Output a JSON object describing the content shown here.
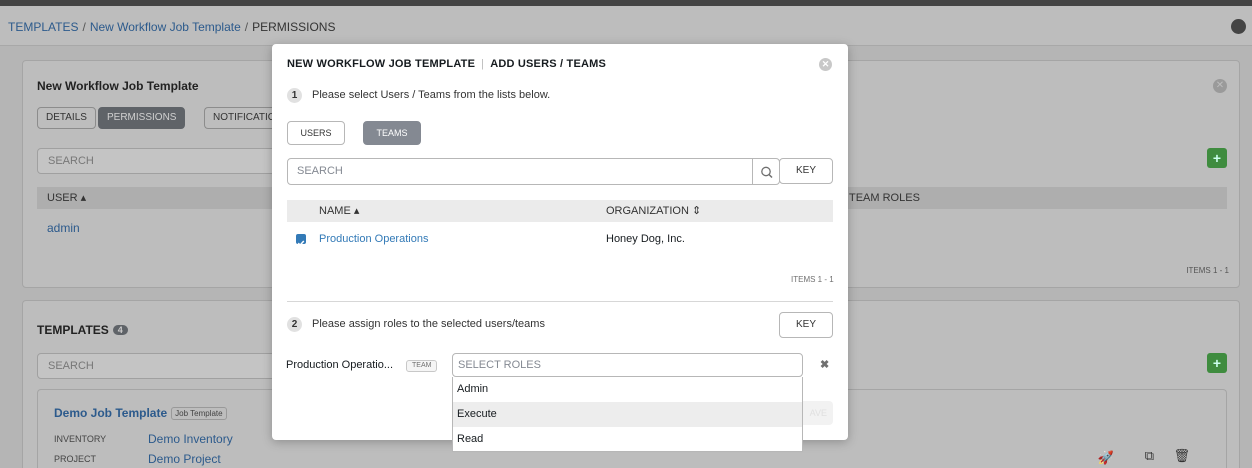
{
  "breadcrumb": {
    "items": [
      "TEMPLATES",
      "New Workflow Job Template",
      "PERMISSIONS"
    ],
    "separator": "/"
  },
  "bg_panel": {
    "title": "New Workflow Job Template",
    "tabs": [
      "DETAILS",
      "PERMISSIONS",
      "NOTIFICATIO"
    ],
    "search_placeholder": "SEARCH",
    "column_user": "USER",
    "column_team_roles": "TEAM ROLES",
    "row_user": "admin",
    "items_label": "ITEMS 1 - 1"
  },
  "templates_panel": {
    "title": "TEMPLATES",
    "count": "4",
    "search_placeholder": "SEARCH",
    "card_title": "Demo Job Template",
    "card_tag": "Job Template",
    "inventory_label": "INVENTORY",
    "inventory_value": "Demo Inventory",
    "project_label": "PROJECT",
    "project_value": "Demo Project"
  },
  "modal": {
    "title_left": "NEW WORKFLOW JOB TEMPLATE",
    "title_right": "ADD USERS / TEAMS",
    "step1_num": "1",
    "step1_text": "Please select Users / Teams from the lists below.",
    "toggle_users": "USERS",
    "toggle_teams": "TEAMS",
    "search_placeholder": "SEARCH",
    "key_label": "KEY",
    "column_name": "NAME",
    "column_org": "ORGANIZATION",
    "row_name": "Production Operations",
    "row_org": "Honey Dog, Inc.",
    "items_label": "ITEMS 1 - 1",
    "step2_num": "2",
    "step2_text": "Please assign roles to the selected users/teams",
    "key2_label": "KEY",
    "role_user": "Production Operatio...",
    "role_user_tag": "TEAM",
    "roles_placeholder": "SELECT ROLES",
    "role_options": [
      "Admin",
      "Execute",
      "Read"
    ],
    "save_label": "AVE"
  },
  "colors": {
    "accent_blue": "#337ab7",
    "active_toggle": "#848992",
    "add_green": "#5cb85c"
  }
}
